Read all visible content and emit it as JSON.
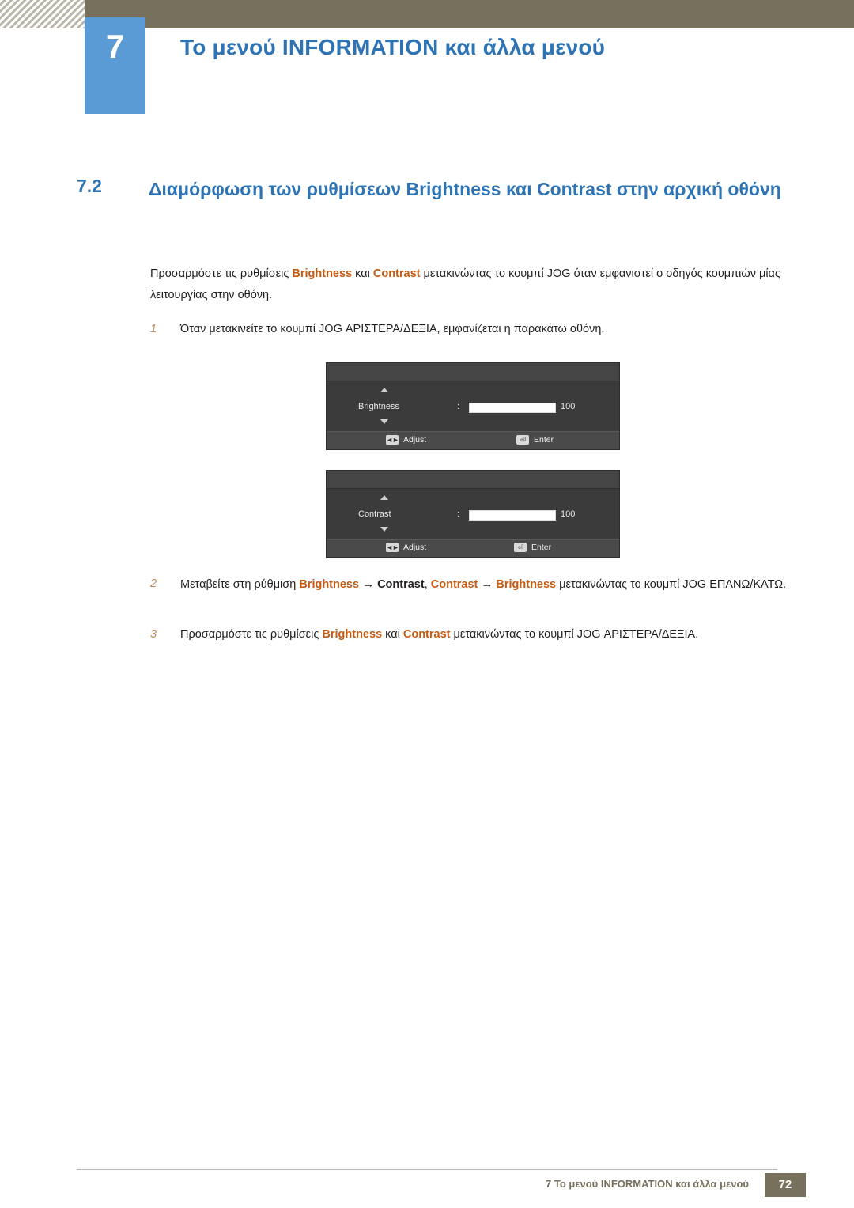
{
  "header": {
    "chapter_number": "7",
    "chapter_title": "Το μενού INFORMATION και άλλα μενού"
  },
  "section": {
    "number": "7.2",
    "title": "Διαμόρφωση των ρυθμίσεων Brightness και Contrast στην αρχική οθόνη"
  },
  "intro": {
    "part1": "Προσαρμόστε τις ρυθμίσεις ",
    "bold1": "Brightness",
    "part2": " και ",
    "bold2": "Contrast",
    "part3": " μετακινώντας το κουμπί JOG όταν εμφανιστεί ο οδηγός κουμπιών μίας λειτουργίας στην οθόνη."
  },
  "steps": [
    {
      "num": "1",
      "text": "Όταν μετακινείτε το κουμπί JOG ΑΡΙΣΤΕΡΑ/ΔΕΞΙΑ, εμφανίζεται η παρακάτω οθόνη."
    },
    {
      "num": "2",
      "p1": "Μεταβείτε στη ρύθμιση ",
      "b1": "Brightness",
      "arrow1": "→",
      "b2": "Contrast",
      "sep": ", ",
      "b3": "Contrast",
      "arrow2": "→",
      "b4": "Brightness",
      "p2": " μετακινώντας το κουμπί JOG ΕΠΑΝΩ/ΚΑΤΩ."
    },
    {
      "num": "3",
      "p1": "Προσαρμόστε τις ρυθμίσεις ",
      "b1": "Brightness",
      "p2": " και ",
      "b2": "Contrast",
      "p3": " μετακινώντας το κουμπί JOG ΑΡΙΣΤΕΡΑ/ΔΕΞΙΑ."
    }
  ],
  "osd": [
    {
      "label": "Brightness",
      "colon": ":",
      "value": "100",
      "adjust": "Adjust",
      "enter": "Enter",
      "adjust_icon": "◄►",
      "enter_icon": "⏎"
    },
    {
      "label": "Contrast",
      "colon": ":",
      "value": "100",
      "adjust": "Adjust",
      "enter": "Enter",
      "adjust_icon": "◄►",
      "enter_icon": "⏎"
    }
  ],
  "footer": {
    "text": "7 Το μενού INFORMATION και άλλα μενού",
    "page": "72"
  }
}
